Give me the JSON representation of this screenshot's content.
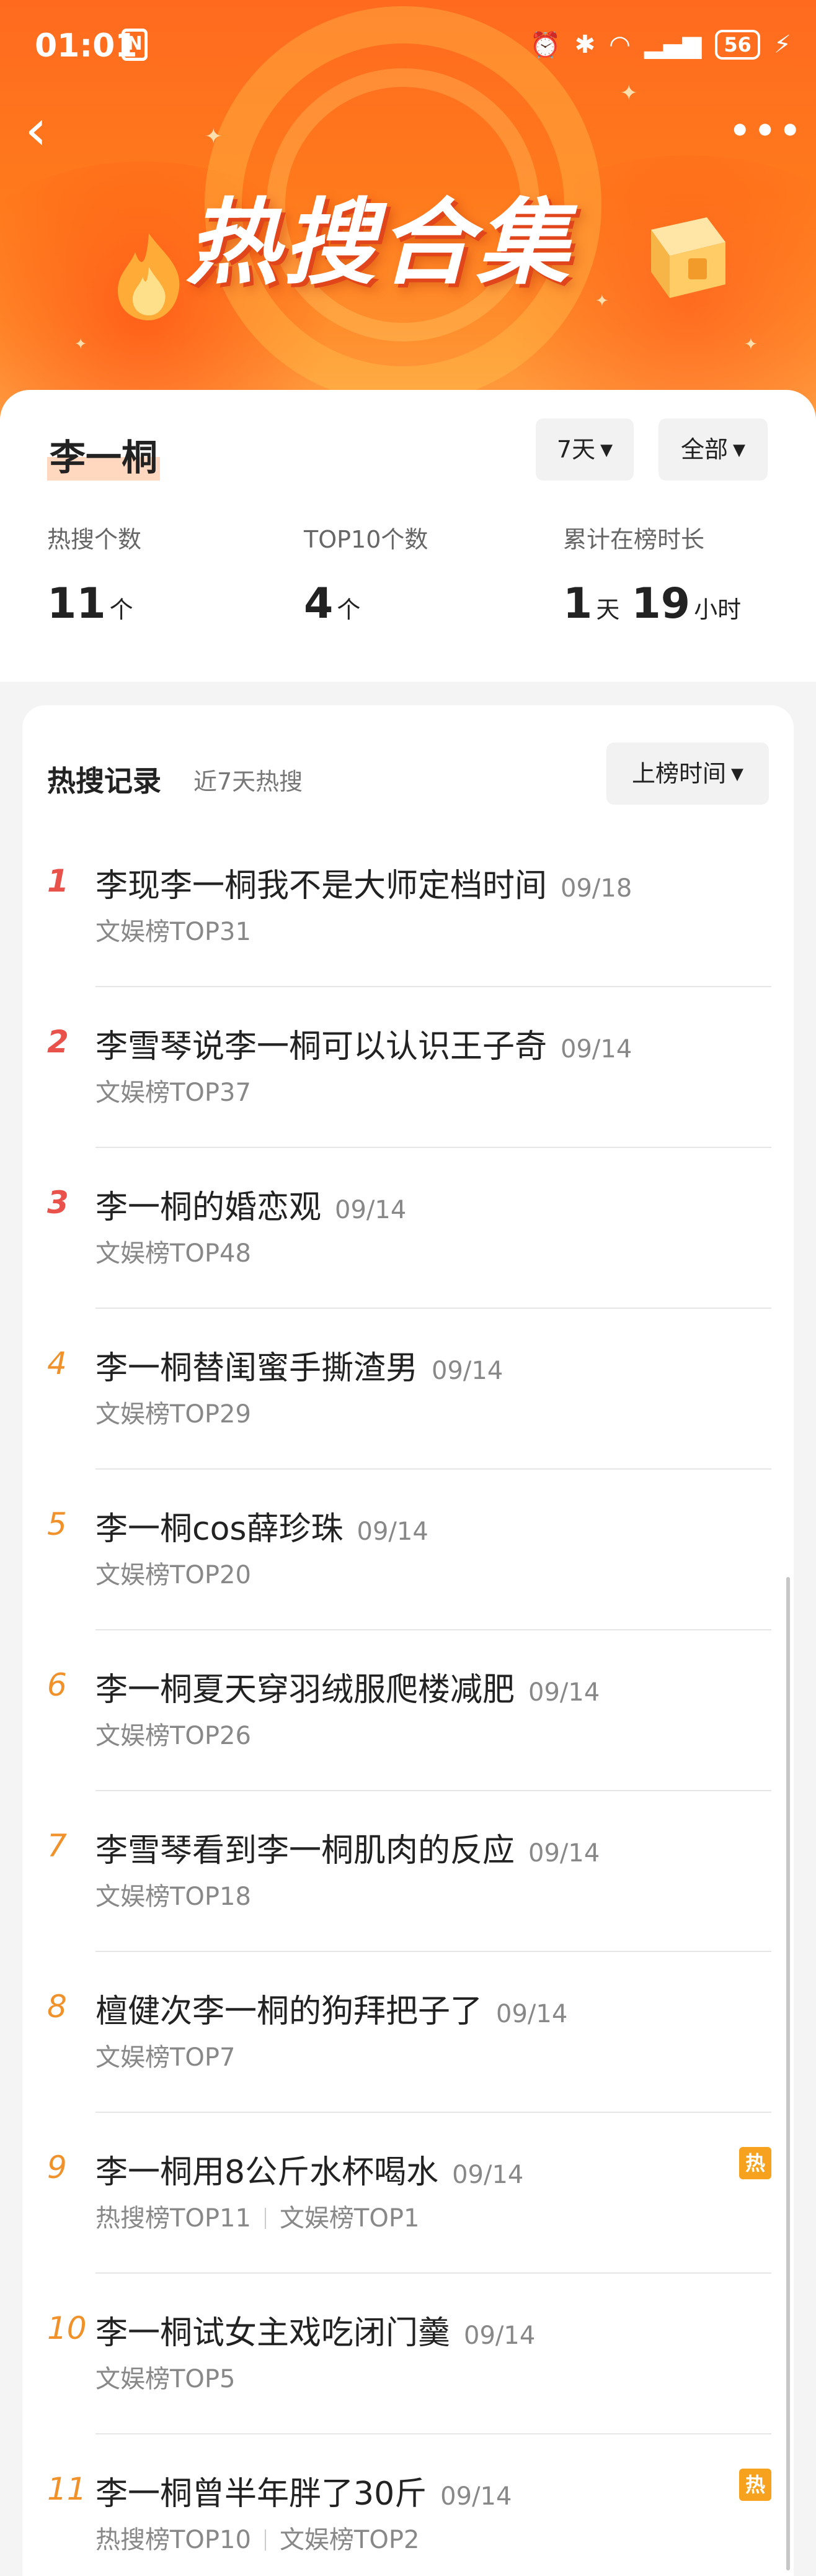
{
  "status_bar": {
    "time": "01:01",
    "nfc": "N",
    "battery": "56"
  },
  "header": {
    "title": "热搜合集",
    "back_icon": "back-arrow-icon",
    "more_icon": "more-icon"
  },
  "profile": {
    "name": "李一桐",
    "filters": {
      "days": "7天",
      "type": "全部"
    },
    "stats": [
      {
        "label": "热搜个数",
        "value": "11",
        "unit": "个"
      },
      {
        "label": "TOP10个数",
        "value": "4",
        "unit": "个"
      },
      {
        "label": "累计在榜时长",
        "value1": "1",
        "unit1": "天",
        "value2": "19",
        "unit2": "小时"
      }
    ]
  },
  "records": {
    "title": "热搜记录",
    "subtitle": "近7天热搜",
    "sort_label": "上榜时间",
    "items": [
      {
        "rank": "1",
        "title": "李现李一桐我不是大师定档时间",
        "date": "09/18",
        "meta": [
          "文娱榜TOP31"
        ],
        "hot": false
      },
      {
        "rank": "2",
        "title": "李雪琴说李一桐可以认识王子奇",
        "date": "09/14",
        "meta": [
          "文娱榜TOP37"
        ],
        "hot": false
      },
      {
        "rank": "3",
        "title": "李一桐的婚恋观",
        "date": "09/14",
        "meta": [
          "文娱榜TOP48"
        ],
        "hot": false
      },
      {
        "rank": "4",
        "title": "李一桐替闺蜜手撕渣男",
        "date": "09/14",
        "meta": [
          "文娱榜TOP29"
        ],
        "hot": false
      },
      {
        "rank": "5",
        "title": "李一桐cos薛珍珠",
        "date": "09/14",
        "meta": [
          "文娱榜TOP20"
        ],
        "hot": false
      },
      {
        "rank": "6",
        "title": "李一桐夏天穿羽绒服爬楼减肥",
        "date": "09/14",
        "meta": [
          "文娱榜TOP26"
        ],
        "hot": false
      },
      {
        "rank": "7",
        "title": "李雪琴看到李一桐肌肉的反应",
        "date": "09/14",
        "meta": [
          "文娱榜TOP18"
        ],
        "hot": false
      },
      {
        "rank": "8",
        "title": "檀健次李一桐的狗拜把子了",
        "date": "09/14",
        "meta": [
          "文娱榜TOP7"
        ],
        "hot": false
      },
      {
        "rank": "9",
        "title": "李一桐用8公斤水杯喝水",
        "date": "09/14",
        "meta": [
          "热搜榜TOP11",
          "文娱榜TOP1"
        ],
        "hot": true,
        "hot_label": "热"
      },
      {
        "rank": "10",
        "title": "李一桐试女主戏吃闭门羹",
        "date": "09/14",
        "meta": [
          "文娱榜TOP5"
        ],
        "hot": false
      },
      {
        "rank": "11",
        "title": "李一桐曾半年胖了30斤",
        "date": "09/14",
        "meta": [
          "热搜榜TOP10",
          "文娱榜TOP2"
        ],
        "hot": true,
        "hot_label": "热"
      }
    ]
  },
  "colors": {
    "rank_top": "#e8524a",
    "rank_rest": "#f0912a",
    "hot_badge": "#f6a21e",
    "hero_orange": "#ff7a1c"
  }
}
